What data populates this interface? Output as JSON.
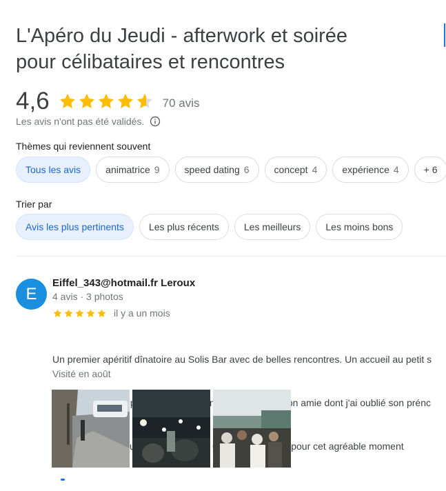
{
  "place": {
    "title_line1": "L'Apéro du Jeudi - afterwork et soirée",
    "title_line2": "pour célibataires et rencontres"
  },
  "rating": {
    "value": "4,6",
    "value_numeric": 4.6,
    "stars_out_of": 5,
    "review_count_label": "70 avis",
    "disclaimer": "Les avis n'ont pas été validés.",
    "star_color": "#fbbc04",
    "star_empty_color": "#dadce0"
  },
  "themes": {
    "label": "Thèmes qui reviennent souvent",
    "chips": [
      {
        "label": "Tous les avis",
        "count": "",
        "selected": true
      },
      {
        "label": "animatrice",
        "count": "9",
        "selected": false
      },
      {
        "label": "speed dating",
        "count": "6",
        "selected": false
      },
      {
        "label": "concept",
        "count": "4",
        "selected": false
      },
      {
        "label": "expérience",
        "count": "4",
        "selected": false
      },
      {
        "label": "+ 6",
        "count": "",
        "selected": false
      }
    ]
  },
  "sort": {
    "label": "Trier par",
    "options": [
      {
        "label": "Avis les plus pertinents",
        "selected": true
      },
      {
        "label": "Les plus récents",
        "selected": false
      },
      {
        "label": "Les meilleurs",
        "selected": false
      },
      {
        "label": "Les moins bons",
        "selected": false
      }
    ]
  },
  "review": {
    "avatar_letter": "E",
    "avatar_color": "#1a8fe0",
    "name": "Eiffel_343@hotmail.fr Leroux",
    "meta": "4 avis · 3 photos",
    "stars": 5,
    "date": "il y a un mois",
    "text_lines": [
      "Un premier apéritif dînatoire au Solis Bar avec de belles rencontres. Un accueil au petit s",
      "agréable moment passé avec Emmanuel, Caroline et son amie dont j'ai oublié son prénc",
      "qu'elle ne m'en voudra pas), Sandra, Gérard et Laurent pour cet agréable moment"
    ],
    "visit": "Visité en août",
    "photos": [
      "street-photo",
      "bar-night-photo",
      "crowd-party-photo"
    ]
  },
  "colors": {
    "accent": "#1a73e8",
    "chip_selected_bg": "#e8f0fe",
    "chip_selected_text": "#1967d2"
  }
}
